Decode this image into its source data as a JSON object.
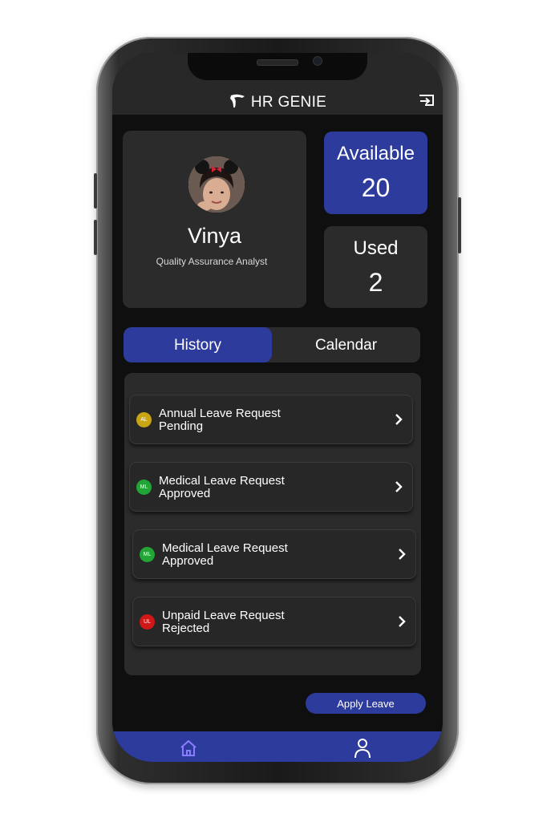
{
  "app": {
    "title": "HR GENIE",
    "logo_icon": "hr-genie-logo-icon",
    "logout_icon": "logout-icon"
  },
  "profile": {
    "name": "Vinya",
    "role": "Quality Assurance Analyst",
    "avatar_icon": "avatar"
  },
  "stats": {
    "available_label": "Available",
    "available_value": "20",
    "used_label": "Used",
    "used_value": "2"
  },
  "tabs": [
    {
      "label": "History",
      "active": true
    },
    {
      "label": "Calendar",
      "active": false
    }
  ],
  "leave_requests": [
    {
      "badge": "AL",
      "badge_color": "#c9a514",
      "title": "Annual Leave Request",
      "status": "Pending"
    },
    {
      "badge": "ML",
      "badge_color": "#22a536",
      "title": "Medical Leave Request",
      "status": "Approved"
    },
    {
      "badge": "ML",
      "badge_color": "#22a536",
      "title": "Medical Leave Request",
      "status": "Approved"
    },
    {
      "badge": "UL",
      "badge_color": "#d01818",
      "title": "Unpaid Leave Request",
      "status": "Rejected"
    }
  ],
  "actions": {
    "apply_leave": "Apply Leave"
  },
  "bottom_nav": [
    {
      "icon": "home-icon",
      "active": true
    },
    {
      "icon": "profile-icon",
      "active": false
    }
  ],
  "colors": {
    "accent": "#2d3b9c",
    "card": "#2b2b2b",
    "background": "#0f0f0f",
    "home_icon_active": "#8a7cff"
  }
}
